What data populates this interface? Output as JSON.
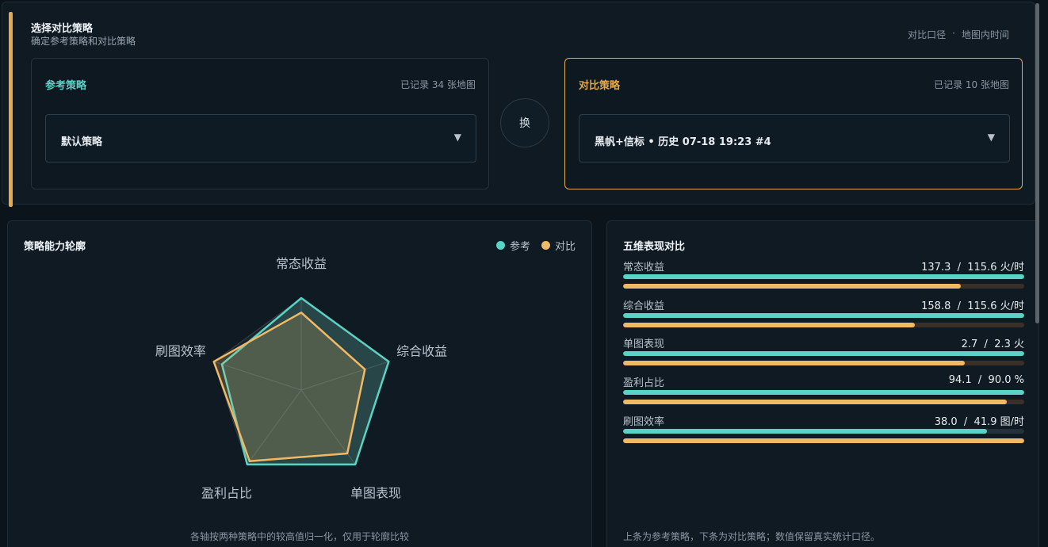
{
  "header": {
    "title": "选择对比策略",
    "subtitle": "确定参考策略和对比策略",
    "meta_left": "对比口径",
    "meta_sep": "·",
    "meta_right": "地图内时间"
  },
  "reference": {
    "label": "参考策略",
    "count": "已记录 34 张地图",
    "selected": "默认策略",
    "arrow": "▼"
  },
  "compare": {
    "label": "对比策略",
    "count": "已记录 10 张地图",
    "selected": "黑帆+信标 • 历史 07-18 19:23 #4",
    "arrow": "▼"
  },
  "swap_label": "换",
  "radar": {
    "title": "策略能力轮廓",
    "legend_ref": "参考",
    "legend_cmp": "对比",
    "footnote": "各轴按两种策略中的较高值归一化，仅用于轮廓比较",
    "axes": [
      "常态收益",
      "综合收益",
      "单图表现",
      "盈利占比",
      "刷图效率"
    ],
    "ref_values": [
      1.0,
      1.0,
      1.0,
      1.0,
      0.907
    ],
    "cmp_values": [
      0.842,
      0.728,
      0.852,
      0.956,
      1.0
    ],
    "colors": {
      "ref": "#59d3c5",
      "cmp": "#f0b965"
    }
  },
  "bars": {
    "title": "五维表现对比",
    "footnote": "上条为参考策略，下条为对比策略；数值保留真实统计口径。",
    "metrics": [
      {
        "name": "常态收益",
        "values": "137.3  /  115.6 火/时",
        "ref": 1.0,
        "cmp": 0.842
      },
      {
        "name": "综合收益",
        "values": "158.8  /  115.6 火/时",
        "ref": 1.0,
        "cmp": 0.728
      },
      {
        "name": "单图表现",
        "values": "2.7  /  2.3 火",
        "ref": 1.0,
        "cmp": 0.852
      },
      {
        "name": "盈利占比",
        "values": "94.1  /  90.0 %",
        "ref": 1.0,
        "cmp": 0.956
      },
      {
        "name": "刷图效率",
        "values": "38.0  /  41.9 图/时",
        "ref": 0.907,
        "cmp": 1.0
      }
    ]
  }
}
